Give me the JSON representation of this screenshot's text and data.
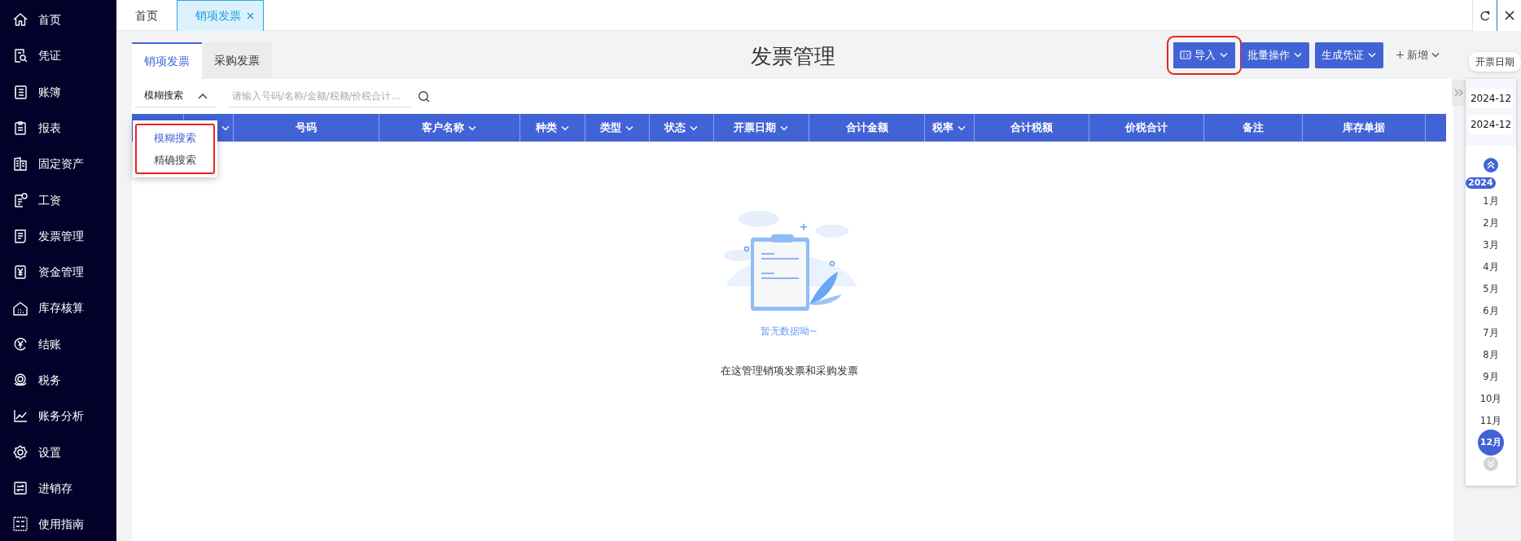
{
  "sidebar": {
    "items": [
      {
        "label": "首页"
      },
      {
        "label": "凭证"
      },
      {
        "label": "账簿"
      },
      {
        "label": "报表"
      },
      {
        "label": "固定资产"
      },
      {
        "label": "工资"
      },
      {
        "label": "发票管理"
      },
      {
        "label": "资金管理"
      },
      {
        "label": "库存核算"
      },
      {
        "label": "结账"
      },
      {
        "label": "税务"
      },
      {
        "label": "账务分析"
      },
      {
        "label": "设置"
      },
      {
        "label": "进销存"
      },
      {
        "label": "使用指南"
      }
    ]
  },
  "open_tabs": [
    {
      "label": "首页",
      "selected": false,
      "closable": false
    },
    {
      "label": "销项发票",
      "selected": true,
      "closable": true
    }
  ],
  "invoice_tabs": [
    {
      "label": "销项发票",
      "selected": true
    },
    {
      "label": "采购发票",
      "selected": false
    }
  ],
  "title": "发票管理",
  "actions": [
    {
      "label": "导入",
      "kind": "icon-button",
      "dropdown": true,
      "highlighted": true
    },
    {
      "label": "批量操作",
      "kind": "button",
      "dropdown": true,
      "highlighted": false
    },
    {
      "label": "生成凭证",
      "kind": "button",
      "dropdown": true,
      "highlighted": false
    },
    {
      "label": "新增",
      "kind": "add-link",
      "dropdown": true,
      "highlighted": false
    }
  ],
  "search": {
    "mode": "模糊搜索",
    "expanded": true,
    "placeholder": "请输入号码/名称/金额/税额/价税合计..."
  },
  "search_menu": {
    "highlighted": true,
    "items": [
      {
        "label": "模糊搜索",
        "selected": true
      },
      {
        "label": "精确搜索",
        "selected": false
      }
    ]
  },
  "table": {
    "columns": [
      {
        "filter": true
      },
      {
        "label": "号码",
        "filter": false
      },
      {
        "label": "客户名称",
        "filter": true
      },
      {
        "label": "种类",
        "filter": true
      },
      {
        "label": "类型",
        "filter": true
      },
      {
        "label": "状态",
        "filter": true
      },
      {
        "label": "开票日期",
        "filter": true
      },
      {
        "label": "合计金额",
        "filter": false
      },
      {
        "label": "税率",
        "filter": true
      },
      {
        "label": "合计税额",
        "filter": false
      },
      {
        "label": "价税合计",
        "filter": false
      },
      {
        "label": "备注",
        "filter": false
      },
      {
        "label": "库存单据",
        "filter": false
      }
    ],
    "empty_message": "暂无数据呦~"
  },
  "hint": "在这管理销项发票和采购发票",
  "calendar": {
    "tooltip": "开票日期",
    "range": [
      "2024-12",
      "2024-12"
    ],
    "year": "2024",
    "months": [
      {
        "label": "1月",
        "selected": false
      },
      {
        "label": "2月",
        "selected": false
      },
      {
        "label": "3月",
        "selected": false
      },
      {
        "label": "4月",
        "selected": false
      },
      {
        "label": "5月",
        "selected": false
      },
      {
        "label": "6月",
        "selected": false
      },
      {
        "label": "7月",
        "selected": false
      },
      {
        "label": "8月",
        "selected": false
      },
      {
        "label": "9月",
        "selected": false
      },
      {
        "label": "10月",
        "selected": false
      },
      {
        "label": "11月",
        "selected": false
      },
      {
        "label": "12月",
        "selected": true
      }
    ]
  }
}
